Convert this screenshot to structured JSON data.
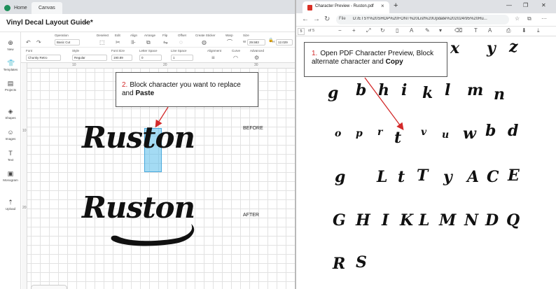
{
  "app": {
    "tabs": [
      {
        "label": "Home"
      },
      {
        "label": "Canvas"
      }
    ],
    "document_title": "Vinyl Decal Layout Guide*",
    "toolbar1": {
      "operation": {
        "label": "Operation",
        "value": "Basic Cut"
      },
      "deselect": "Deselect",
      "edit": "Edit",
      "align": "Align",
      "arrange": "Arrange",
      "flip": "Flip",
      "offset": "Offset",
      "create_sticker": "Create Sticker",
      "warp": "Warp",
      "size": {
        "label": "Size",
        "w_label": "W",
        "w_value": "29.583",
        "h_label": "H",
        "h_value": "12.029"
      }
    },
    "toolbar2": {
      "font": {
        "label": "Font",
        "value": "Chunky Retro"
      },
      "style": {
        "label": "Style",
        "value": "Regular"
      },
      "font_size": {
        "label": "Font Size",
        "value": "190.89"
      },
      "letter_space": {
        "label": "Letter Space",
        "value": "0"
      },
      "line_space": {
        "label": "Line Space",
        "value": "1"
      },
      "alignment": "Alignment",
      "curve": "Curve",
      "advanced": "Advanced"
    },
    "rail": [
      {
        "label": "New",
        "icon": "plus-icon"
      },
      {
        "label": "Templates",
        "icon": "shirt-icon"
      },
      {
        "label": "Projects",
        "icon": "projects-icon"
      },
      {
        "label": "Shapes",
        "icon": "shapes-icon"
      },
      {
        "label": "Images",
        "icon": "image-icon"
      },
      {
        "label": "Text",
        "icon": "text-icon"
      },
      {
        "label": "Monogram",
        "icon": "monogram-icon"
      },
      {
        "label": "Upload",
        "icon": "upload-icon"
      }
    ],
    "ruler": {
      "top": [
        "10",
        "20",
        "30"
      ],
      "left": [
        "10",
        "20"
      ]
    },
    "canvas": {
      "word": "Ruston",
      "before_label": "BEFORE",
      "after_label": "AFTER"
    },
    "callout2": {
      "number": "2.",
      "text": "Block character you want to replace and ",
      "bold": "Paste"
    }
  },
  "browser": {
    "tab_title": "Character Preview - Ruston.pdf",
    "file_label": "File",
    "url": "D:/ETSY%20SHOP%20FONT%20List%20Update%202024/95%20Ru...",
    "page_current": "5",
    "page_of": "of 5",
    "callout1": {
      "number": "1.",
      "text": "Open PDF Character Preview, Block alternate character and ",
      "bold": "Copy"
    },
    "glyph_rows": [
      [
        "x",
        "y",
        "z"
      ],
      [
        "g",
        "b",
        "h",
        "i",
        "k",
        "l",
        "m",
        "n"
      ],
      [
        "o",
        "p",
        "r",
        "t",
        "v",
        "u",
        "w",
        "b",
        "d"
      ],
      [
        "g",
        "L",
        "t",
        "T",
        "y",
        "A",
        "C",
        "E"
      ],
      [
        "G",
        "H",
        "I",
        "K",
        "L",
        "M",
        "N",
        "D",
        "Q"
      ],
      [
        "R",
        "S"
      ]
    ]
  },
  "colors": {
    "accent": "#d32a2a",
    "selection": "#5abeeb",
    "brand": "#1e8f5a"
  }
}
